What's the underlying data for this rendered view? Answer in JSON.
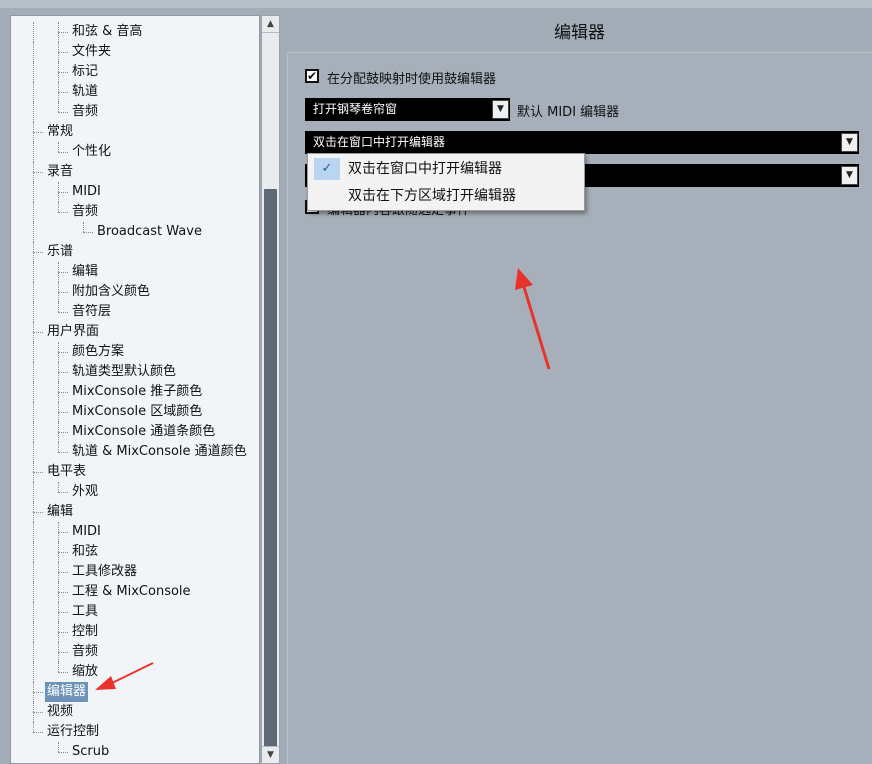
{
  "title": "编辑器",
  "tree": [
    {
      "label": "和弦 & 音高",
      "level": 2,
      "last": false
    },
    {
      "label": "文件夹",
      "level": 2,
      "last": false
    },
    {
      "label": "标记",
      "level": 2,
      "last": false
    },
    {
      "label": "轨道",
      "level": 2,
      "last": false
    },
    {
      "label": "音频",
      "level": 2,
      "last": true
    },
    {
      "label": "常规",
      "level": 1,
      "last": false
    },
    {
      "label": "个性化",
      "level": 2,
      "last": true
    },
    {
      "label": "录音",
      "level": 1,
      "last": false
    },
    {
      "label": "MIDI",
      "level": 2,
      "last": false
    },
    {
      "label": "音频",
      "level": 2,
      "last": true
    },
    {
      "label": "Broadcast Wave",
      "level": 3,
      "last": true
    },
    {
      "label": "乐谱",
      "level": 1,
      "last": false
    },
    {
      "label": "编辑",
      "level": 2,
      "last": false
    },
    {
      "label": "附加含义颜色",
      "level": 2,
      "last": false
    },
    {
      "label": "音符层",
      "level": 2,
      "last": true
    },
    {
      "label": "用户界面",
      "level": 1,
      "last": false
    },
    {
      "label": "颜色方案",
      "level": 2,
      "last": false
    },
    {
      "label": "轨道类型默认颜色",
      "level": 2,
      "last": false
    },
    {
      "label": "MixConsole 推子颜色",
      "level": 2,
      "last": false
    },
    {
      "label": "MixConsole 区域颜色",
      "level": 2,
      "last": false
    },
    {
      "label": "MixConsole 通道条颜色",
      "level": 2,
      "last": false
    },
    {
      "label": "轨道 & MixConsole 通道颜色",
      "level": 2,
      "last": true
    },
    {
      "label": "电平表",
      "level": 1,
      "last": false
    },
    {
      "label": "外观",
      "level": 2,
      "last": true
    },
    {
      "label": "编辑",
      "level": 1,
      "last": false
    },
    {
      "label": "MIDI",
      "level": 2,
      "last": false
    },
    {
      "label": "和弦",
      "level": 2,
      "last": false
    },
    {
      "label": "工具修改器",
      "level": 2,
      "last": false
    },
    {
      "label": "工程 & MixConsole",
      "level": 2,
      "last": false
    },
    {
      "label": "工具",
      "level": 2,
      "last": false
    },
    {
      "label": "控制",
      "level": 2,
      "last": false
    },
    {
      "label": "音频",
      "level": 2,
      "last": false
    },
    {
      "label": "缩放",
      "level": 2,
      "last": true
    },
    {
      "label": "编辑器",
      "level": 1,
      "last": false,
      "selected": true
    },
    {
      "label": "视频",
      "level": 1,
      "last": false
    },
    {
      "label": "运行控制",
      "level": 1,
      "last": true
    },
    {
      "label": "Scrub",
      "level": 2,
      "last": true
    }
  ],
  "settings": {
    "use_drum_editor_label": "在分配鼓映射时使用鼓编辑器",
    "use_drum_editor_checked": true,
    "default_editor_value": "打开钢琴卷帘窗",
    "default_editor_label": "默认 MIDI 编辑器",
    "open_mode_value": "双击在窗口中打开编辑器",
    "third_checkbox_partial_label": "编辑器内容跟随选定事件"
  },
  "dropdown": {
    "options": [
      {
        "label": "双击在窗口中打开编辑器",
        "checked": true
      },
      {
        "label": "双击在下方区域打开编辑器",
        "checked": false
      }
    ]
  },
  "icons": {
    "checkmark": "✓",
    "check-mark-bold": "✔",
    "combo-arrow": "▼",
    "scroll-up": "▲",
    "scroll-down": "▼"
  },
  "colors": {
    "selection": "#6d93b8",
    "annotation_arrow": "#e8322b"
  }
}
